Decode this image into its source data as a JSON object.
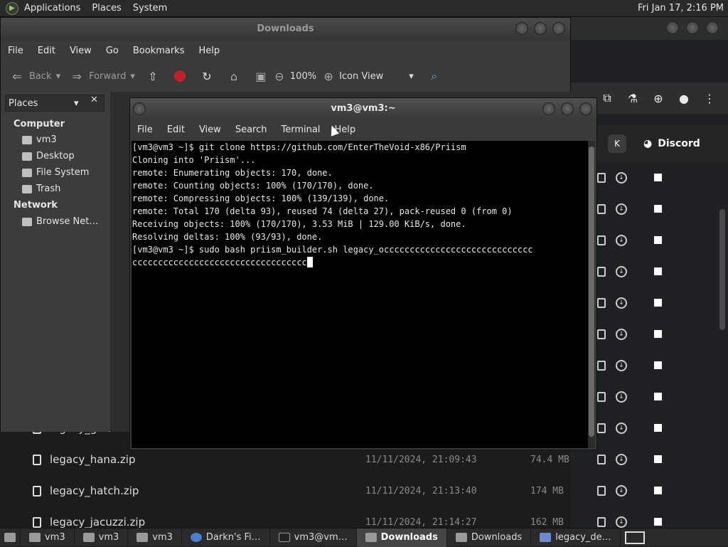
{
  "top_panel": {
    "menus": [
      "Applications",
      "Places",
      "System"
    ],
    "clock": "Fri Jan 17, 2:16 PM"
  },
  "file_manager": {
    "title": "Downloads",
    "menu": [
      "File",
      "Edit",
      "View",
      "Go",
      "Bookmarks",
      "Help"
    ],
    "toolbar": {
      "back": "Back",
      "forward": "Forward",
      "zoom": "100%",
      "view_mode": "Icon View"
    },
    "places_label": "Places",
    "sidebar": {
      "computer_heading": "Computer",
      "computer_items": [
        "vm3",
        "Desktop",
        "File System",
        "Trash"
      ],
      "network_heading": "Network",
      "network_items": [
        "Browse Net…"
      ]
    }
  },
  "terminal": {
    "title": "vm3@vm3:~",
    "menu": [
      "File",
      "Edit",
      "View",
      "Search",
      "Terminal",
      "Help"
    ],
    "lines": [
      "[vm3@vm3 ~]$ git clone https://github.com/EnterTheVoid-x86/Priism",
      "Cloning into 'Priism'...",
      "remote: Enumerating objects: 170, done.",
      "remote: Counting objects: 100% (170/170), done.",
      "remote: Compressing objects: 100% (139/139), done.",
      "remote: Total 170 (delta 93), reused 74 (delta 27), pack-reused 0 (from 0)",
      "Receiving objects: 100% (170/170), 3.53 MiB | 129.00 KiB/s, done.",
      "Resolving deltas: 100% (93/93), done.",
      "[vm3@vm3 ~]$ sudo bash priism_builder.sh legacy_occccccccccccccccccccccccccccc",
      "cccccccccccccccccccccccccccccccccc"
    ]
  },
  "browser": {
    "k_button": "K",
    "discord_label": "Discord",
    "files": [
      {
        "name": "legacy_grunt.zip",
        "date": "",
        "size": ""
      },
      {
        "name": "legacy_hana.zip",
        "date": "11/11/2024, 21:09:43",
        "size": "74.4 MB"
      },
      {
        "name": "legacy_hatch.zip",
        "date": "11/11/2024, 21:13:40",
        "size": "174 MB"
      },
      {
        "name": "legacy_jacuzzi.zip",
        "date": "11/11/2024, 21:14:27",
        "size": "162 MB"
      }
    ]
  },
  "taskbar": [
    {
      "label": "vm3",
      "active": false
    },
    {
      "label": "vm3",
      "active": false
    },
    {
      "label": "vm3",
      "active": false
    },
    {
      "label": "Darkn's Fi…",
      "active": false
    },
    {
      "label": "vm3@vm…",
      "active": false
    },
    {
      "label": "Downloads",
      "active": true
    },
    {
      "label": "Downloads",
      "active": false
    },
    {
      "label": "legacy_de…",
      "active": false
    }
  ],
  "colors": {
    "terminal_bg": "#000000",
    "panel_bg": "#2a2a2a",
    "record_red": "#c0202a"
  }
}
